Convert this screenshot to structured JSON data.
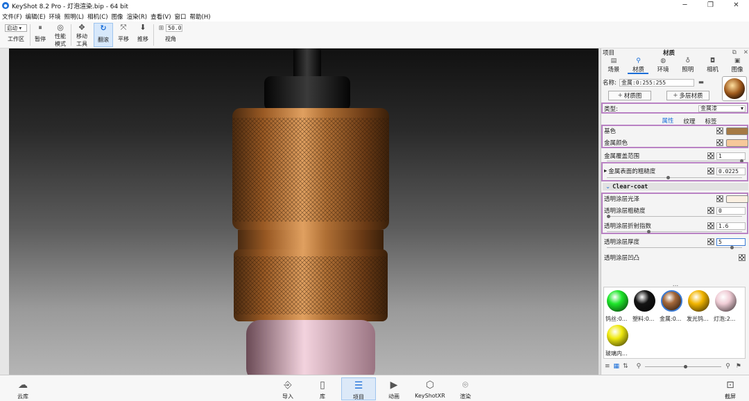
{
  "window": {
    "title": "KeyShot 8.2 Pro  - 灯泡渲染.bip  - 64 bit"
  },
  "menu": [
    "文件(F)",
    "编辑(E)",
    "环境",
    "照明(L)",
    "相机(C)",
    "图像",
    "渲染(R)",
    "查看(V)",
    "窗口",
    "帮助(H)"
  ],
  "toolbar": {
    "workspace_select": "启动",
    "workspace_label": "工作区",
    "pause": "暂停",
    "perf_mode_1": "性能",
    "perf_mode_2": "模式",
    "move_tool_1": "移动",
    "move_tool_2": "工具",
    "tumble": "翻滚",
    "pan": "平移",
    "dolly": "推移",
    "fov_value": "50.0",
    "fov_label": "视角"
  },
  "panel": {
    "left_title": "项目",
    "center_title": "材质",
    "tabs": [
      "场景",
      "材质",
      "环境",
      "照明",
      "相机",
      "图像"
    ],
    "active_tab": "材质",
    "name_label": "名称:",
    "name_value": "金属:0:255:255",
    "material_graph": "材质图",
    "multi_layer": "多层材质",
    "type_label": "类型:",
    "type_value": "金属漆",
    "subtabs": [
      "属性",
      "纹理",
      "标签"
    ],
    "active_subtab": "属性",
    "base_color_label": "基色",
    "base_color": "#a57a45",
    "metal_color_label": "金属颜色",
    "metal_color": "#f6c89a",
    "metal_coverage_label": "金属覆盖范围",
    "metal_coverage": "1",
    "metal_roughness_label": "金属表面的粗糙度",
    "metal_roughness": "0.0225",
    "metal_roughness_level": 0.45,
    "clearcoat_header": "Clear-coat",
    "cc_gloss_label": "透明涂层光泽",
    "cc_gloss_color": "#faf0e2",
    "cc_roughness_label": "透明涂层粗糙度",
    "cc_roughness": "0",
    "cc_ior_label": "透明涂层折射指数",
    "cc_ior": "1.6",
    "cc_thickness_label": "透明涂层厚度",
    "cc_thickness": "5",
    "cc_bump_label": "透明涂层凹凸"
  },
  "library": {
    "dots": "...",
    "items": [
      {
        "label": "钨丝:0...",
        "color": "#1ee62a"
      },
      {
        "label": "塑料:0...",
        "color": "#141414"
      },
      {
        "label": "金属:0...",
        "color": "#a4683a"
      },
      {
        "label": "发光钨...",
        "color": "#f2b500"
      },
      {
        "label": "灯泡:2...",
        "color": "#f0cdd6"
      },
      {
        "label": "玻璃内...",
        "color": "#f0ea10"
      }
    ]
  },
  "bottombar": {
    "cloud": "云库",
    "import": "导入",
    "library": "库",
    "project": "项目",
    "animation": "动画",
    "xr": "KeyShotXR",
    "render": "渲染",
    "screenshot": "截屏"
  }
}
